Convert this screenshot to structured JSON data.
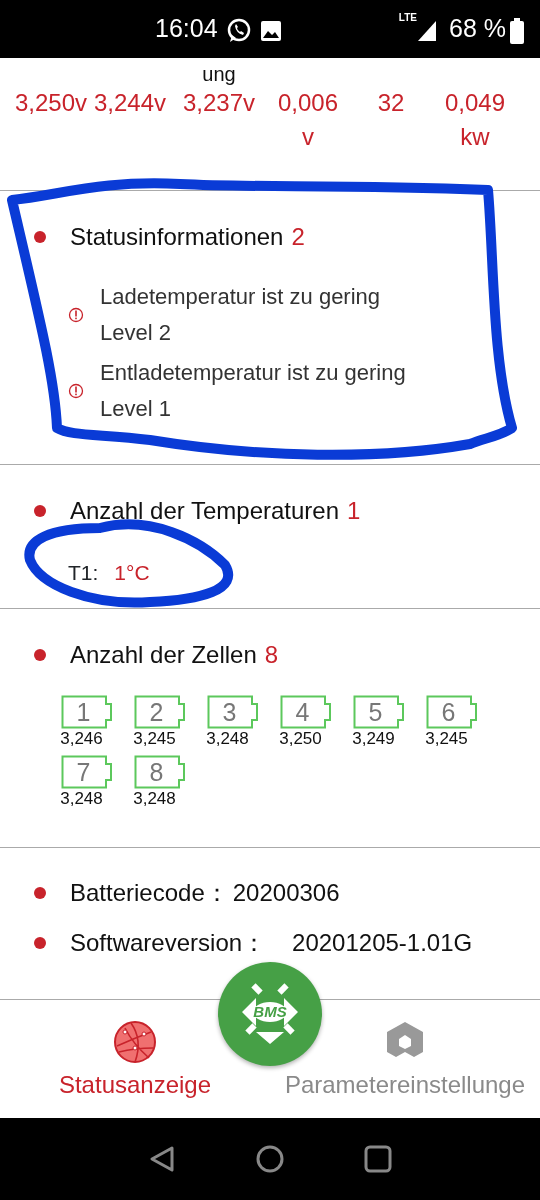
{
  "status_bar": {
    "time": "16:04",
    "network": "LTE",
    "battery": "68 %"
  },
  "readings": [
    {
      "value": "3,250v"
    },
    {
      "value": "3,244v"
    },
    {
      "value": "3,237v",
      "heading": "ung"
    },
    {
      "value": "0,006",
      "unit": "v"
    },
    {
      "value": "32"
    },
    {
      "value": "0,049",
      "unit": "kw"
    }
  ],
  "status_info": {
    "title": "Statusinformationen",
    "count": "2",
    "alerts": [
      {
        "message": "Ladetemperatur ist zu gering",
        "level": "Level 2"
      },
      {
        "message": "Entladetemperatur ist zu gering",
        "level": "Level 1"
      }
    ]
  },
  "temperatures": {
    "title": "Anzahl der Temperaturen",
    "count": "1",
    "sensors": [
      {
        "label": "T1:",
        "value": "1°C"
      }
    ]
  },
  "cells": {
    "title": "Anzahl der Zellen",
    "count": "8",
    "items": [
      {
        "number": "1",
        "voltage": "3,246"
      },
      {
        "number": "2",
        "voltage": "3,245"
      },
      {
        "number": "3",
        "voltage": "3,248"
      },
      {
        "number": "4",
        "voltage": "3,250"
      },
      {
        "number": "5",
        "voltage": "3,249"
      },
      {
        "number": "6",
        "voltage": "3,245"
      },
      {
        "number": "7",
        "voltage": "3,248"
      },
      {
        "number": "8",
        "voltage": "3,248"
      }
    ]
  },
  "info": [
    {
      "label": "Batteriecode：",
      "value": "20200306"
    },
    {
      "label": "Softwareversion：",
      "value": "20201205-1.01G"
    }
  ],
  "bottom_nav": {
    "center_button": "BMS",
    "tabs": [
      {
        "label": "Statusanzeige",
        "kind": "status",
        "selected": true
      },
      {
        "label": "Parametereinstellunge",
        "kind": "settings",
        "selected": false
      }
    ]
  }
}
